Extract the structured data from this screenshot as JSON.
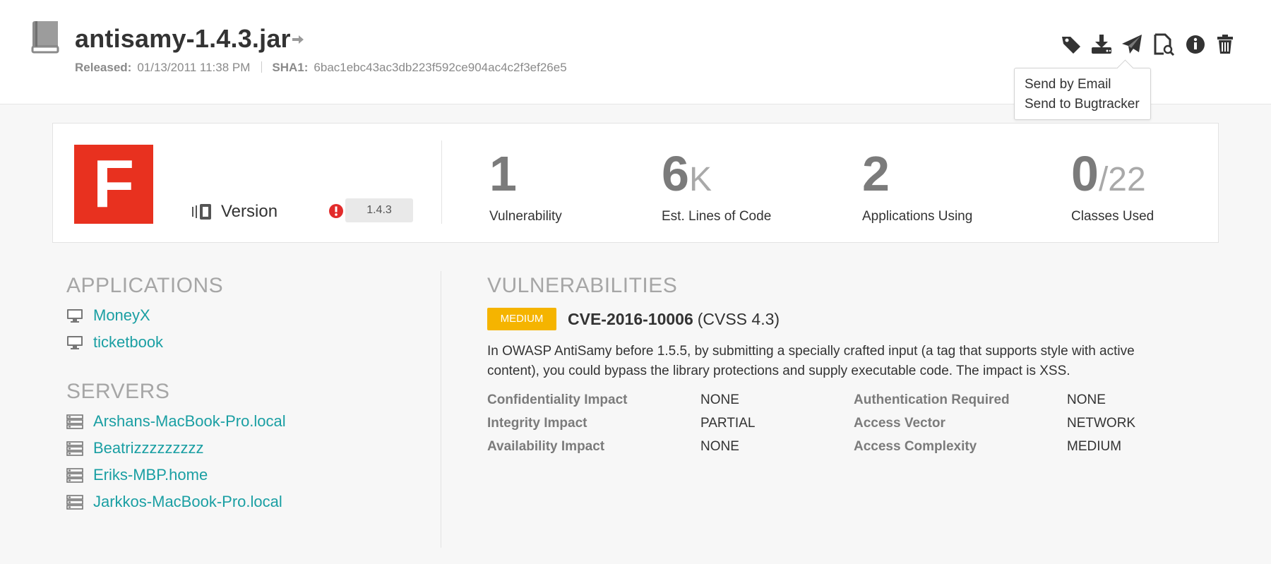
{
  "header": {
    "title": "antisamy-1.4.3.jar",
    "released_label": "Released:",
    "released_value": "01/13/2011 11:38 PM",
    "sha1_label": "SHA1:",
    "sha1_value": "6bac1ebc43ac3db223f592ce904ac4c2f3ef26e5",
    "actions": [
      "tag-icon",
      "download-icon",
      "send-icon",
      "document-search-icon",
      "info-icon",
      "trash-icon"
    ]
  },
  "send_menu": {
    "items": [
      "Send by Email",
      "Send to Bugtracker"
    ]
  },
  "summary": {
    "grade": "F",
    "grade_color": "#e8311f",
    "version_label": "Version",
    "version_value": "1.4.3",
    "stats": [
      {
        "value": "1",
        "suffix": "",
        "label": "Vulnerability"
      },
      {
        "value": "6",
        "suffix": "K",
        "label": "Est. Lines of Code"
      },
      {
        "value": "2",
        "suffix": "",
        "label": "Applications Using"
      },
      {
        "value": "0",
        "suffix": "/22",
        "label": "Classes Used"
      }
    ]
  },
  "applications": {
    "heading": "APPLICATIONS",
    "items": [
      "MoneyX",
      "ticketbook"
    ]
  },
  "servers": {
    "heading": "SERVERS",
    "items": [
      "Arshans-MacBook-Pro.local",
      "Beatrizzzzzzzzz",
      "Eriks-MBP.home",
      "Jarkkos-MacBook-Pro.local"
    ]
  },
  "vulnerabilities": {
    "heading": "VULNERABILITIES",
    "severity": "MEDIUM",
    "severity_color": "#f5b400",
    "cve_id": "CVE-2016-10006",
    "cvss": "(CVSS 4.3)",
    "description": "In OWASP AntiSamy before 1.5.5, by submitting a specially crafted input (a tag that supports style with active content), you could bypass the library protections and supply executable code. The impact is XSS.",
    "impacts": [
      {
        "label": "Confidentiality Impact",
        "value": "NONE"
      },
      {
        "label": "Authentication Required",
        "value": "NONE"
      },
      {
        "label": "Integrity Impact",
        "value": "PARTIAL"
      },
      {
        "label": "Access Vector",
        "value": "NETWORK"
      },
      {
        "label": "Availability Impact",
        "value": "NONE"
      },
      {
        "label": "Access Complexity",
        "value": "MEDIUM"
      }
    ]
  },
  "link_color": "#1a9fa3"
}
